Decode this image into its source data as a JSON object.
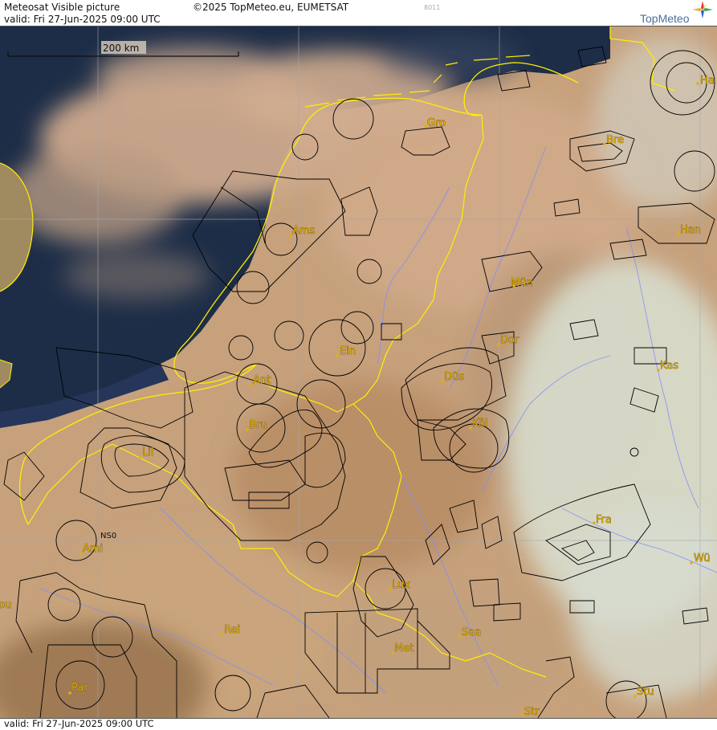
{
  "header": {
    "product": "Meteosat Visible picture",
    "copyright": "©2025 TopMeteo.eu, EUMETSAT",
    "code": "8011",
    "brand": "TopMeteo",
    "valid": "valid:  Fri  27-Jun-2025  09:00 UTC"
  },
  "footer": {
    "valid": "valid:  Fri  27-Jun-2025  09:00 UTC"
  },
  "scale": {
    "label": "200 km"
  },
  "colors": {
    "border": "#ffee00",
    "coast": "#ffee00",
    "rivers": "#7f8cff",
    "grid": "#9aa0a8",
    "airspace": "#000000",
    "city": "#e3b000",
    "sea": "#1c2c45",
    "land": "#c9a580"
  },
  "cities": [
    {
      "name": "Gro"
    },
    {
      "name": "Bre"
    },
    {
      "name": "Ha"
    },
    {
      "name": "Ams"
    },
    {
      "name": "Han"
    },
    {
      "name": "Mün"
    },
    {
      "name": "Ein"
    },
    {
      "name": "Dor"
    },
    {
      "name": "Ant"
    },
    {
      "name": "Kas"
    },
    {
      "name": "Düs"
    },
    {
      "name": "Bru"
    },
    {
      "name": "Köl"
    },
    {
      "name": "Lil"
    },
    {
      "name": "Fra"
    },
    {
      "name": "NS0"
    },
    {
      "name": "Ami"
    },
    {
      "name": "Wü"
    },
    {
      "name": "Lux"
    },
    {
      "name": "Rei"
    },
    {
      "name": "Saa"
    },
    {
      "name": "Met"
    },
    {
      "name": "Par"
    },
    {
      "name": "Stu"
    },
    {
      "name": "Str"
    },
    {
      "name": "ou"
    }
  ]
}
